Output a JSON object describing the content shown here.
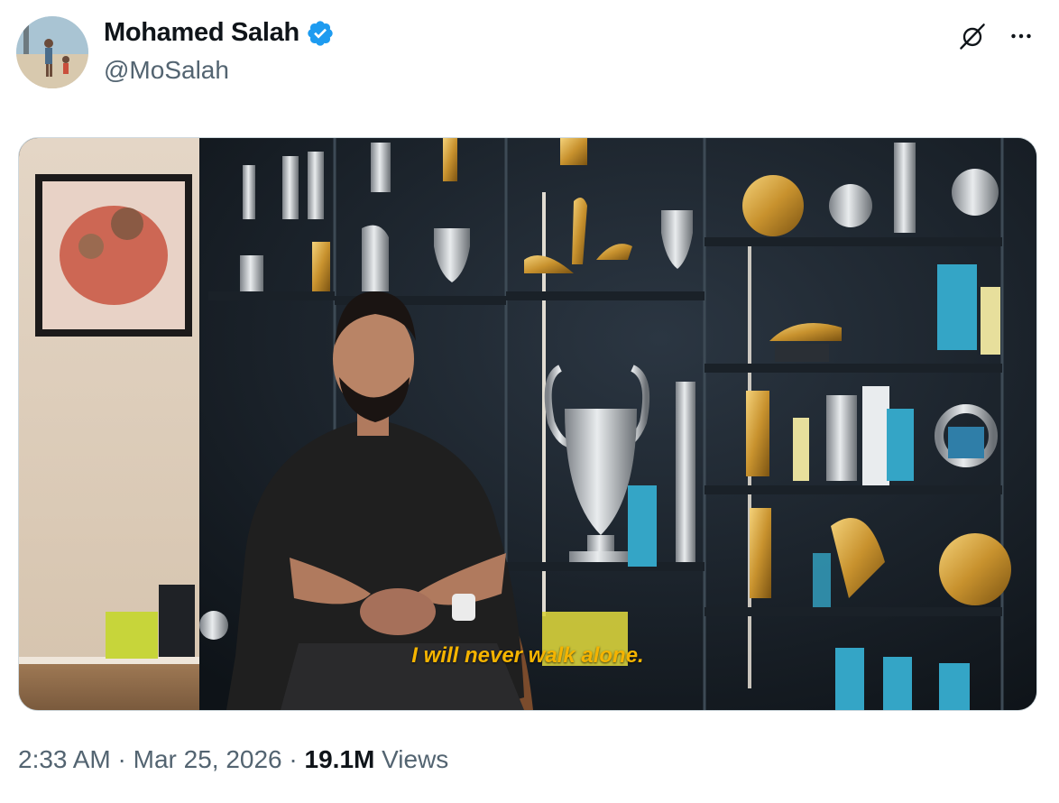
{
  "author": {
    "name": "Mohamed Salah",
    "handle": "@MoSalah",
    "verified": true,
    "verified_color": "#1d9bf0"
  },
  "actions": {
    "grok_icon": "grok-icon",
    "more_icon": "more-icon"
  },
  "media": {
    "caption": "I will never walk alone.",
    "caption_color": "#f5b400"
  },
  "meta": {
    "time": "2:33 AM",
    "separator": " · ",
    "date": "Mar 25, 2026",
    "views_count": "19.1M",
    "views_label": "Views"
  }
}
